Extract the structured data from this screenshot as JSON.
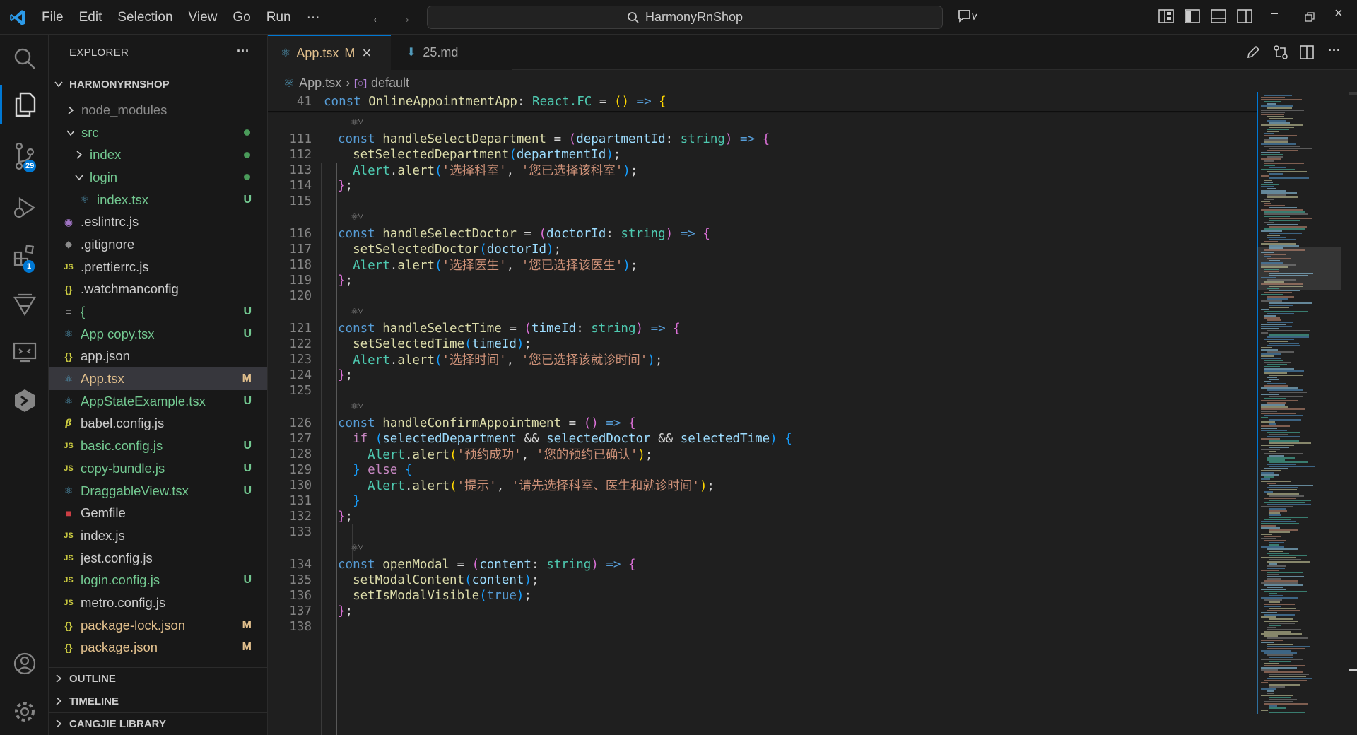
{
  "menu": [
    "File",
    "Edit",
    "Selection",
    "View",
    "Go",
    "Run",
    "···"
  ],
  "search": {
    "text": "HarmonyRnShop"
  },
  "activity_bar": {
    "scm_badge": "29",
    "extensions_badge": "1"
  },
  "explorer": {
    "title": "EXPLORER",
    "more": "···",
    "project": "HARMONYRNSHOP",
    "rows": [
      {
        "label": "node_modules",
        "icon": "chevron-right-icon",
        "status": ""
      },
      {
        "label": "src",
        "icon": "chevron-down-icon",
        "status": "dot"
      },
      {
        "label": "index",
        "icon": "chevron-right-icon",
        "status": "dot"
      },
      {
        "label": "login",
        "icon": "chevron-down-icon",
        "status": "dot"
      },
      {
        "label": "index.tsx",
        "icon": "react-icon",
        "status": "U"
      },
      {
        "label": ".eslintrc.js",
        "icon": "eslint-icon",
        "status": ""
      },
      {
        "label": ".gitignore",
        "icon": "git-icon",
        "status": ""
      },
      {
        "label": ".prettierrc.js",
        "icon": "js-icon",
        "status": ""
      },
      {
        "label": ".watchmanconfig",
        "icon": "json-icon",
        "status": ""
      },
      {
        "label": "{",
        "icon": "text-file-icon",
        "status": "U"
      },
      {
        "label": "App copy.tsx",
        "icon": "react-icon",
        "status": "U"
      },
      {
        "label": "app.json",
        "icon": "json-icon",
        "status": ""
      },
      {
        "label": "App.tsx",
        "icon": "react-icon",
        "status": "M"
      },
      {
        "label": "AppStateExample.tsx",
        "icon": "react-icon",
        "status": "U"
      },
      {
        "label": "babel.config.js",
        "icon": "babel-icon",
        "status": ""
      },
      {
        "label": "basic.config.js",
        "icon": "js-icon",
        "status": "U"
      },
      {
        "label": "copy-bundle.js",
        "icon": "js-icon",
        "status": "U"
      },
      {
        "label": "DraggableView.tsx",
        "icon": "react-icon",
        "status": "U"
      },
      {
        "label": "Gemfile",
        "icon": "ruby-icon",
        "status": ""
      },
      {
        "label": "index.js",
        "icon": "js-icon",
        "status": ""
      },
      {
        "label": "jest.config.js",
        "icon": "js-icon",
        "status": ""
      },
      {
        "label": "login.config.js",
        "icon": "js-icon",
        "status": "U"
      },
      {
        "label": "metro.config.js",
        "icon": "js-icon",
        "status": ""
      },
      {
        "label": "package-lock.json",
        "icon": "json-icon",
        "status": "M"
      },
      {
        "label": "package.json",
        "icon": "json-icon",
        "status": "M"
      }
    ],
    "sections": [
      "OUTLINE",
      "TIMELINE",
      "CANGJIE LIBRARY"
    ]
  },
  "tabs": [
    {
      "label": "App.tsx",
      "status": "M",
      "close": "×"
    },
    {
      "label": "25.md"
    }
  ],
  "breadcrumb": {
    "file": "App.tsx",
    "symbol": "default"
  },
  "sticky": {
    "num": "41"
  },
  "lines": [
    {
      "num": "111"
    },
    {
      "num": "112"
    },
    {
      "num": "113"
    },
    {
      "num": "114"
    },
    {
      "num": "115"
    },
    {
      "num": "116"
    },
    {
      "num": "117"
    },
    {
      "num": "118"
    },
    {
      "num": "119"
    },
    {
      "num": "120"
    },
    {
      "num": "121"
    },
    {
      "num": "122"
    },
    {
      "num": "123"
    },
    {
      "num": "124"
    },
    {
      "num": "125"
    },
    {
      "num": "126"
    },
    {
      "num": "127"
    },
    {
      "num": "128"
    },
    {
      "num": "129"
    },
    {
      "num": "130"
    },
    {
      "num": "131"
    },
    {
      "num": "132"
    },
    {
      "num": "133"
    },
    {
      "num": "134"
    },
    {
      "num": "135"
    },
    {
      "num": "136"
    },
    {
      "num": "137"
    },
    {
      "num": "138"
    }
  ],
  "code": {
    "sticky": {
      "c": "const",
      "name": "OnlineAppointmentApp",
      "type": "React.FC"
    },
    "s113a": "'选择科室'",
    "s113b": "'您已选择该科室'",
    "s118a": "'选择医生'",
    "s118b": "'您已选择该医生'",
    "s123a": "'选择时间'",
    "s123b": "'您已选择该就诊时间'",
    "s128a": "'预约成功'",
    "s128b": "'您的预约已确认'",
    "s130a": "'提示'",
    "s130b": "'请先选择科室、医生和就诊时间'"
  }
}
